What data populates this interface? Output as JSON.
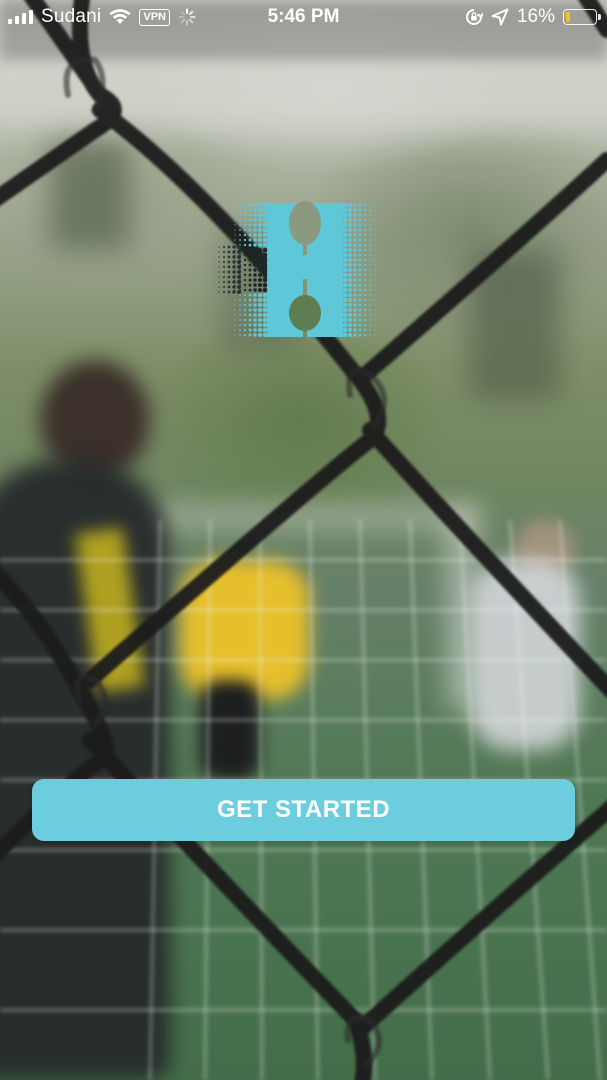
{
  "status_bar": {
    "carrier": "Sudani",
    "vpn_label": "VPN",
    "time": "5:46 PM",
    "battery_percent": "16%",
    "battery_level": 0.16,
    "icons": [
      "signal-bars-icon",
      "wifi-icon",
      "loading-icon",
      "orientation-lock-icon",
      "location-icon",
      "battery-icon"
    ]
  },
  "logo": {
    "icon": "app-logo-h-icon",
    "color": "#5ec8d9"
  },
  "main": {
    "get_started_label": "GET STARTED"
  },
  "colors": {
    "button": "#6ccddf",
    "button_text": "#ffffff",
    "battery_fill": "#f5c518"
  }
}
